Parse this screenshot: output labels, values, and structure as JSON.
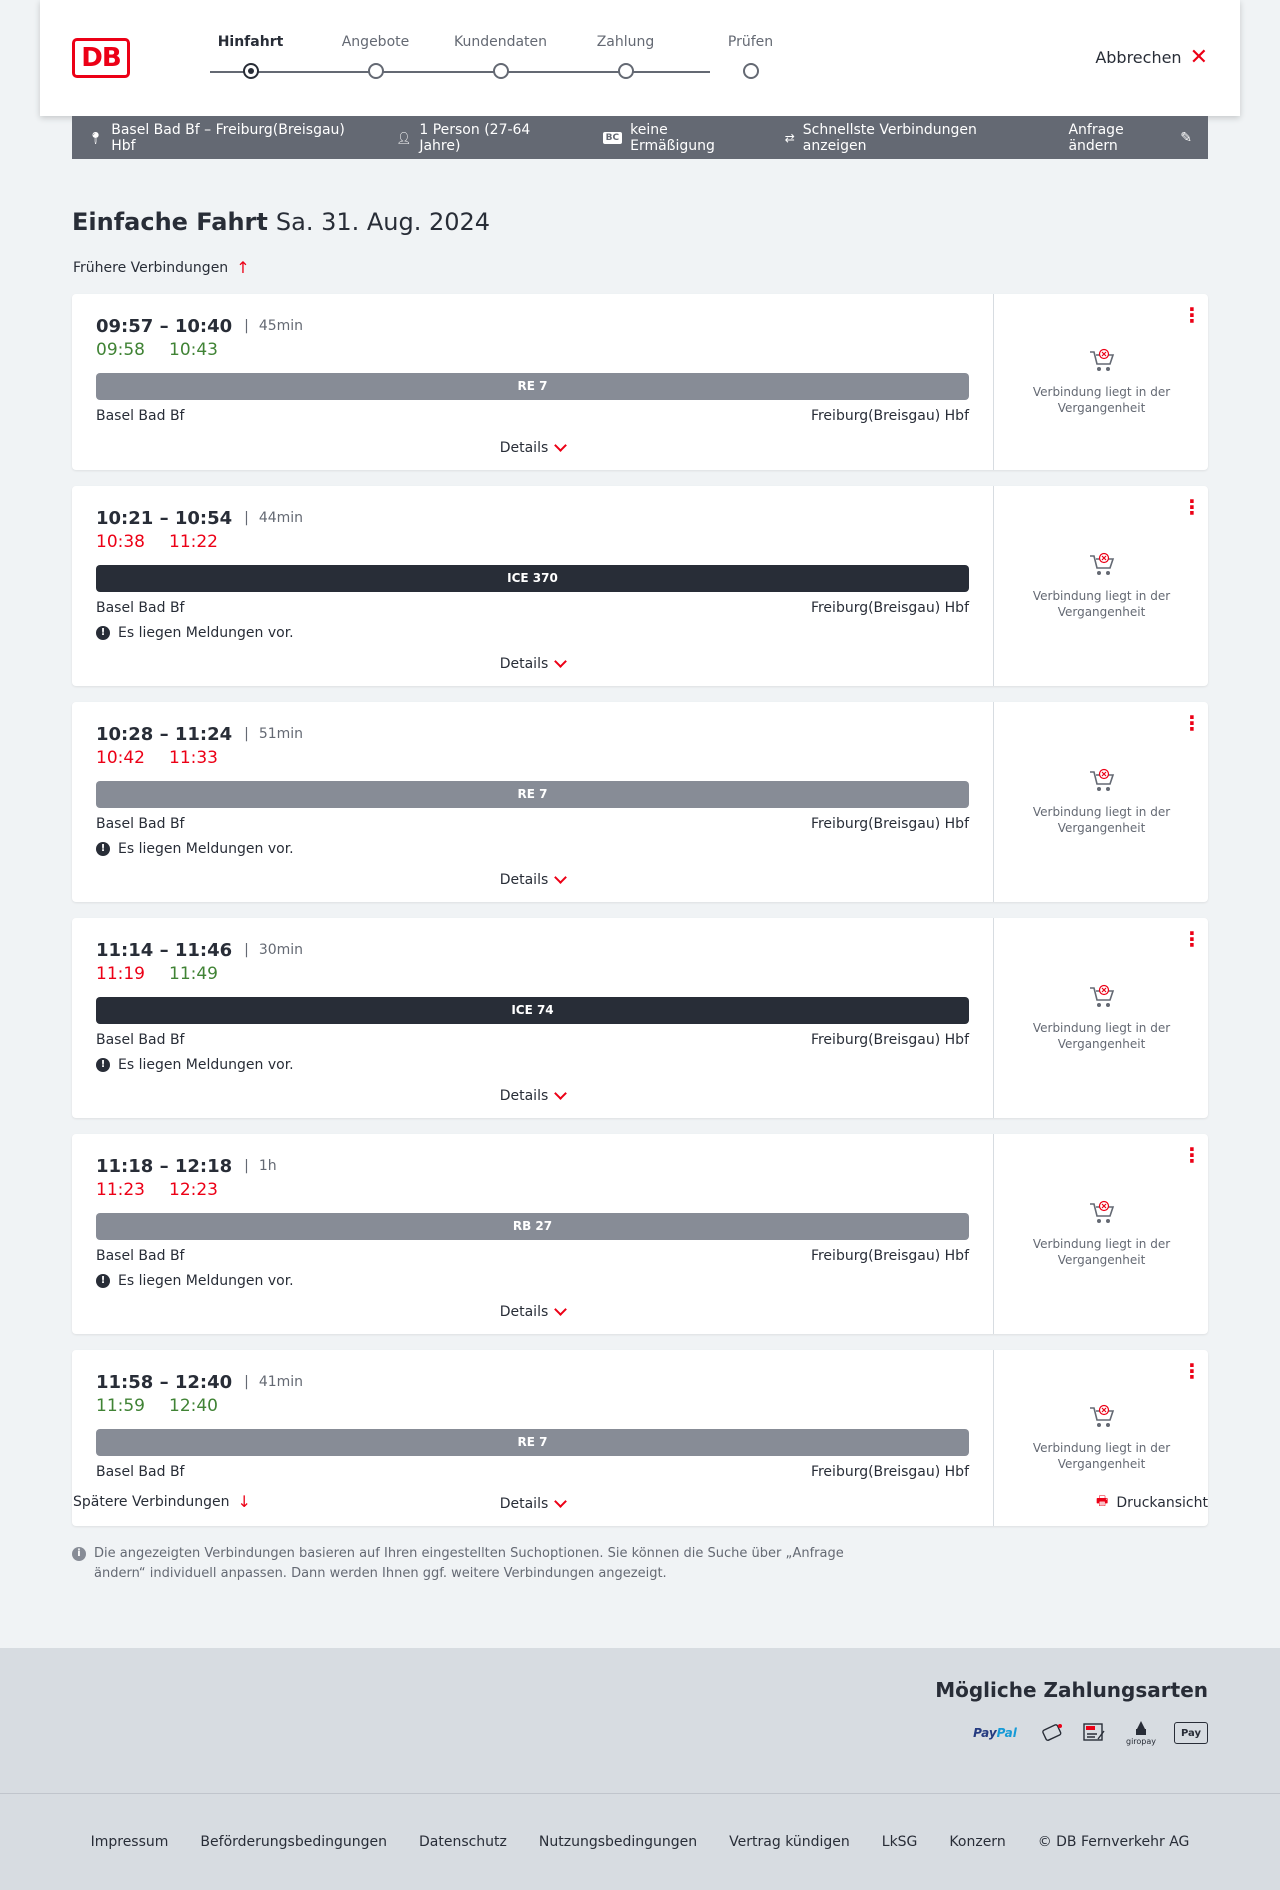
{
  "header": {
    "logo_text": "DB",
    "steps": [
      {
        "label": "Hinfahrt",
        "active": true
      },
      {
        "label": "Angebote",
        "active": false
      },
      {
        "label": "Kundendaten",
        "active": false
      },
      {
        "label": "Zahlung",
        "active": false
      },
      {
        "label": "Prüfen",
        "active": false
      }
    ],
    "cancel_label": "Abbrechen"
  },
  "summary": {
    "route": "Basel Bad Bf – Freiburg(Breisgau) Hbf",
    "travellers": "1 Person (27-64 Jahre)",
    "bc_badge": "BC",
    "discount": "keine Ermäßigung",
    "option": "Schnellste Verbindungen anzeigen",
    "edit_label": "Anfrage ändern"
  },
  "page": {
    "title_bold": "Einfache Fahrt",
    "title_date": "Sa. 31. Aug. 2024",
    "earlier_label": "Frühere Verbindungen",
    "later_label": "Spätere Verbindungen",
    "print_label": "Druckansicht",
    "info_text": "Die angezeigten Verbindungen basieren auf Ihren eingestellten Suchoptionen. Sie können die Suche über „Anfrage ändern“ individuell anpassen. Dann werden Ihnen ggf. weitere Verbindungen angezeigt."
  },
  "connections": [
    {
      "planned": "09:57 – 10:40",
      "duration": "45min",
      "rt_dep": "09:58",
      "rt_dep_color": "green",
      "rt_arr": "10:43",
      "rt_arr_color": "green",
      "train": "RE 7",
      "train_style": "grey",
      "from": "Basel Bad Bf",
      "to": "Freiburg(Breisgau) Hbf",
      "notice": "",
      "details": "Details",
      "status": "Verbindung liegt in der Vergangenheit"
    },
    {
      "planned": "10:21 – 10:54",
      "duration": "44min",
      "rt_dep": "10:38",
      "rt_dep_color": "red",
      "rt_arr": "11:22",
      "rt_arr_color": "red",
      "train": "ICE 370",
      "train_style": "dark",
      "from": "Basel Bad Bf",
      "to": "Freiburg(Breisgau) Hbf",
      "notice": "Es liegen Meldungen vor.",
      "details": "Details",
      "status": "Verbindung liegt in der Vergangenheit"
    },
    {
      "planned": "10:28 – 11:24",
      "duration": "51min",
      "rt_dep": "10:42",
      "rt_dep_color": "red",
      "rt_arr": "11:33",
      "rt_arr_color": "red",
      "train": "RE 7",
      "train_style": "grey",
      "from": "Basel Bad Bf",
      "to": "Freiburg(Breisgau) Hbf",
      "notice": "Es liegen Meldungen vor.",
      "details": "Details",
      "status": "Verbindung liegt in der Vergangenheit"
    },
    {
      "planned": "11:14 – 11:46",
      "duration": "30min",
      "rt_dep": "11:19",
      "rt_dep_color": "red",
      "rt_arr": "11:49",
      "rt_arr_color": "green",
      "train": "ICE 74",
      "train_style": "dark",
      "from": "Basel Bad Bf",
      "to": "Freiburg(Breisgau) Hbf",
      "notice": "Es liegen Meldungen vor.",
      "details": "Details",
      "status": "Verbindung liegt in der Vergangenheit"
    },
    {
      "planned": "11:18 – 12:18",
      "duration": "1h",
      "rt_dep": "11:23",
      "rt_dep_color": "red",
      "rt_arr": "12:23",
      "rt_arr_color": "red",
      "train": "RB 27",
      "train_style": "grey",
      "from": "Basel Bad Bf",
      "to": "Freiburg(Breisgau) Hbf",
      "notice": "Es liegen Meldungen vor.",
      "details": "Details",
      "status": "Verbindung liegt in der Vergangenheit"
    },
    {
      "planned": "11:58 – 12:40",
      "duration": "41min",
      "rt_dep": "11:59",
      "rt_dep_color": "green",
      "rt_arr": "12:40",
      "rt_arr_color": "green",
      "train": "RE 7",
      "train_style": "grey",
      "from": "Basel Bad Bf",
      "to": "Freiburg(Breisgau) Hbf",
      "notice": "",
      "details": "Details",
      "status": "Verbindung liegt in der Vergangenheit"
    }
  ],
  "payment": {
    "title": "Mögliche Zahlungsarten",
    "methods": [
      "PayPal",
      "Credit card",
      "SEPA",
      "giropay",
      "Pay"
    ]
  },
  "footer": {
    "links": [
      "Impressum",
      "Beförderungsbedingungen",
      "Datenschutz",
      "Nutzungsbedingungen",
      "Vertrag kündigen",
      "LkSG",
      "Konzern",
      "© DB Fernverkehr AG"
    ]
  },
  "colors": {
    "accent": "#ec0016",
    "ontime": "#408335",
    "dark": "#282d37",
    "grey": "#646973"
  }
}
